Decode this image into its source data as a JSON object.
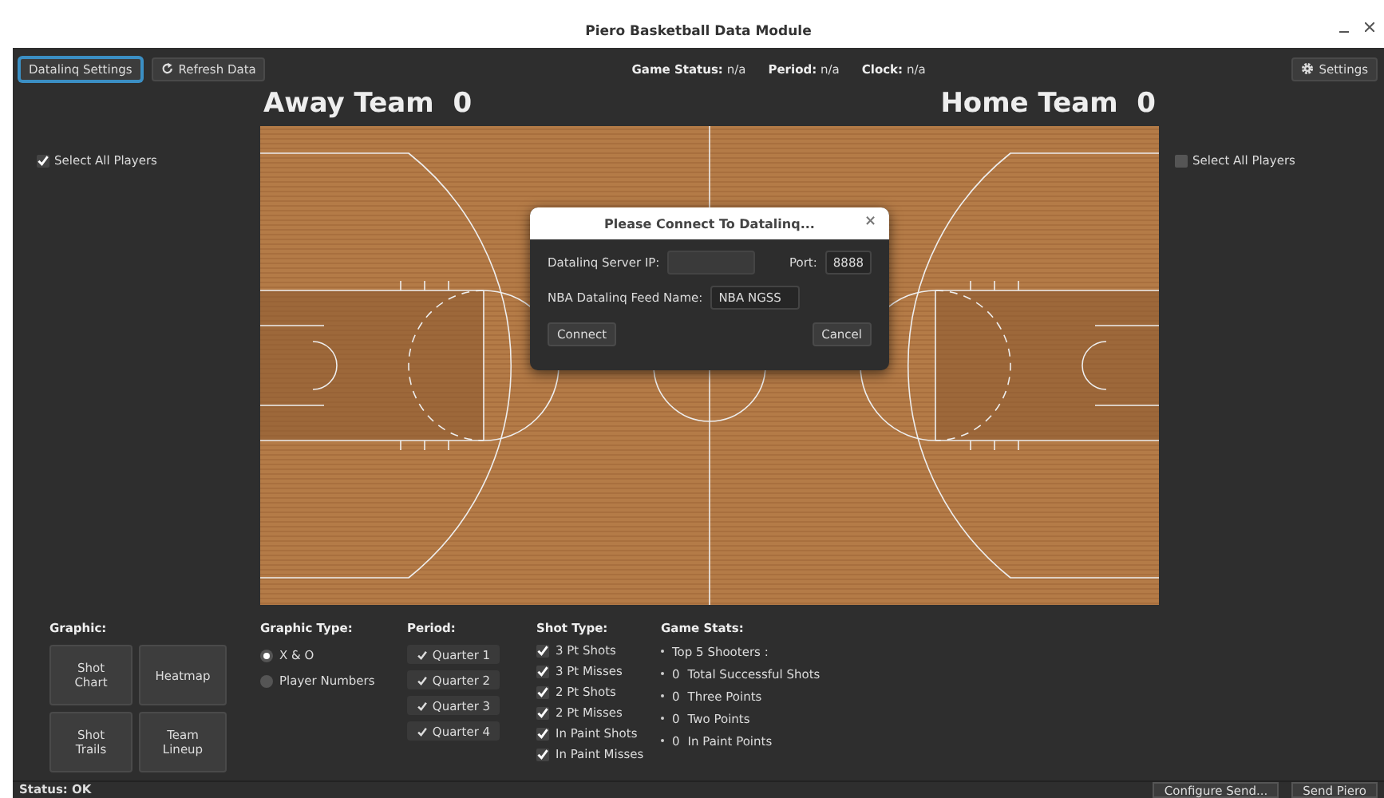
{
  "window": {
    "title": "Piero Basketball Data Module"
  },
  "toolbar": {
    "buttons": [
      {
        "label": "Datalinq Settings",
        "focused": true,
        "kind": "plain"
      },
      {
        "label": "Refresh Data",
        "focused": false,
        "kind": "refresh"
      }
    ],
    "status": [
      {
        "label": "Game Status:",
        "value": "n/a"
      },
      {
        "label": "Period:",
        "value": "n/a"
      },
      {
        "label": "Clock:",
        "value": "n/a"
      }
    ],
    "settings_button": "Settings"
  },
  "away": {
    "name": "Away Team",
    "score": "0",
    "select_all": {
      "label": "Select All  Players",
      "checked": true
    }
  },
  "home": {
    "name": "Home Team",
    "score": "0",
    "select_all": {
      "label": "Select All  Players",
      "checked": false
    }
  },
  "dialog": {
    "title": "Please Connect To Datalinq...",
    "close": "×",
    "server_ip_label": "Datalinq Server IP:",
    "port_label": "Port:",
    "port": "8888",
    "feed_label": "NBA Datalinq Feed Name:",
    "feed": "NBA NGSS",
    "buttons": [
      "Connect",
      "Cancel"
    ]
  },
  "graphic": {
    "title": "Graphic:",
    "buttons": [
      "Shot Chart",
      "Heatmap",
      "Shot Trails",
      "Team Lineup"
    ]
  },
  "graphic_type": {
    "title": "Graphic Type:",
    "options": [
      {
        "label": "X & O",
        "selected": true
      },
      {
        "label": "Player Numbers",
        "selected": false
      }
    ]
  },
  "period": {
    "title": "Period:",
    "items": [
      {
        "label": "Quarter 1",
        "checked": true
      },
      {
        "label": "Quarter 2",
        "checked": true
      },
      {
        "label": "Quarter 3",
        "checked": true
      },
      {
        "label": "Quarter 4",
        "checked": true
      }
    ]
  },
  "shot_type": {
    "title": "Shot Type:",
    "items": [
      {
        "label": "3 Pt Shots",
        "checked": true
      },
      {
        "label": "3 Pt Misses",
        "checked": true
      },
      {
        "label": "2 Pt Shots",
        "checked": true
      },
      {
        "label": "2 Pt Misses",
        "checked": true
      },
      {
        "label": "In Paint Shots",
        "checked": true
      },
      {
        "label": "In Paint Misses",
        "checked": true
      }
    ]
  },
  "game_stats": {
    "title": "Game Stats:",
    "items": [
      {
        "text": "Top 5 Shooters :"
      },
      {
        "count": "0",
        "text": "Total Successful Shots"
      },
      {
        "count": "0",
        "text": "Three Points"
      },
      {
        "count": "0",
        "text": "Two Points"
      },
      {
        "count": "0",
        "text": "In Paint Points"
      }
    ]
  },
  "status_bar": {
    "text": "Status: OK",
    "buttons": [
      "Configure Send...",
      "Send Piero"
    ]
  }
}
